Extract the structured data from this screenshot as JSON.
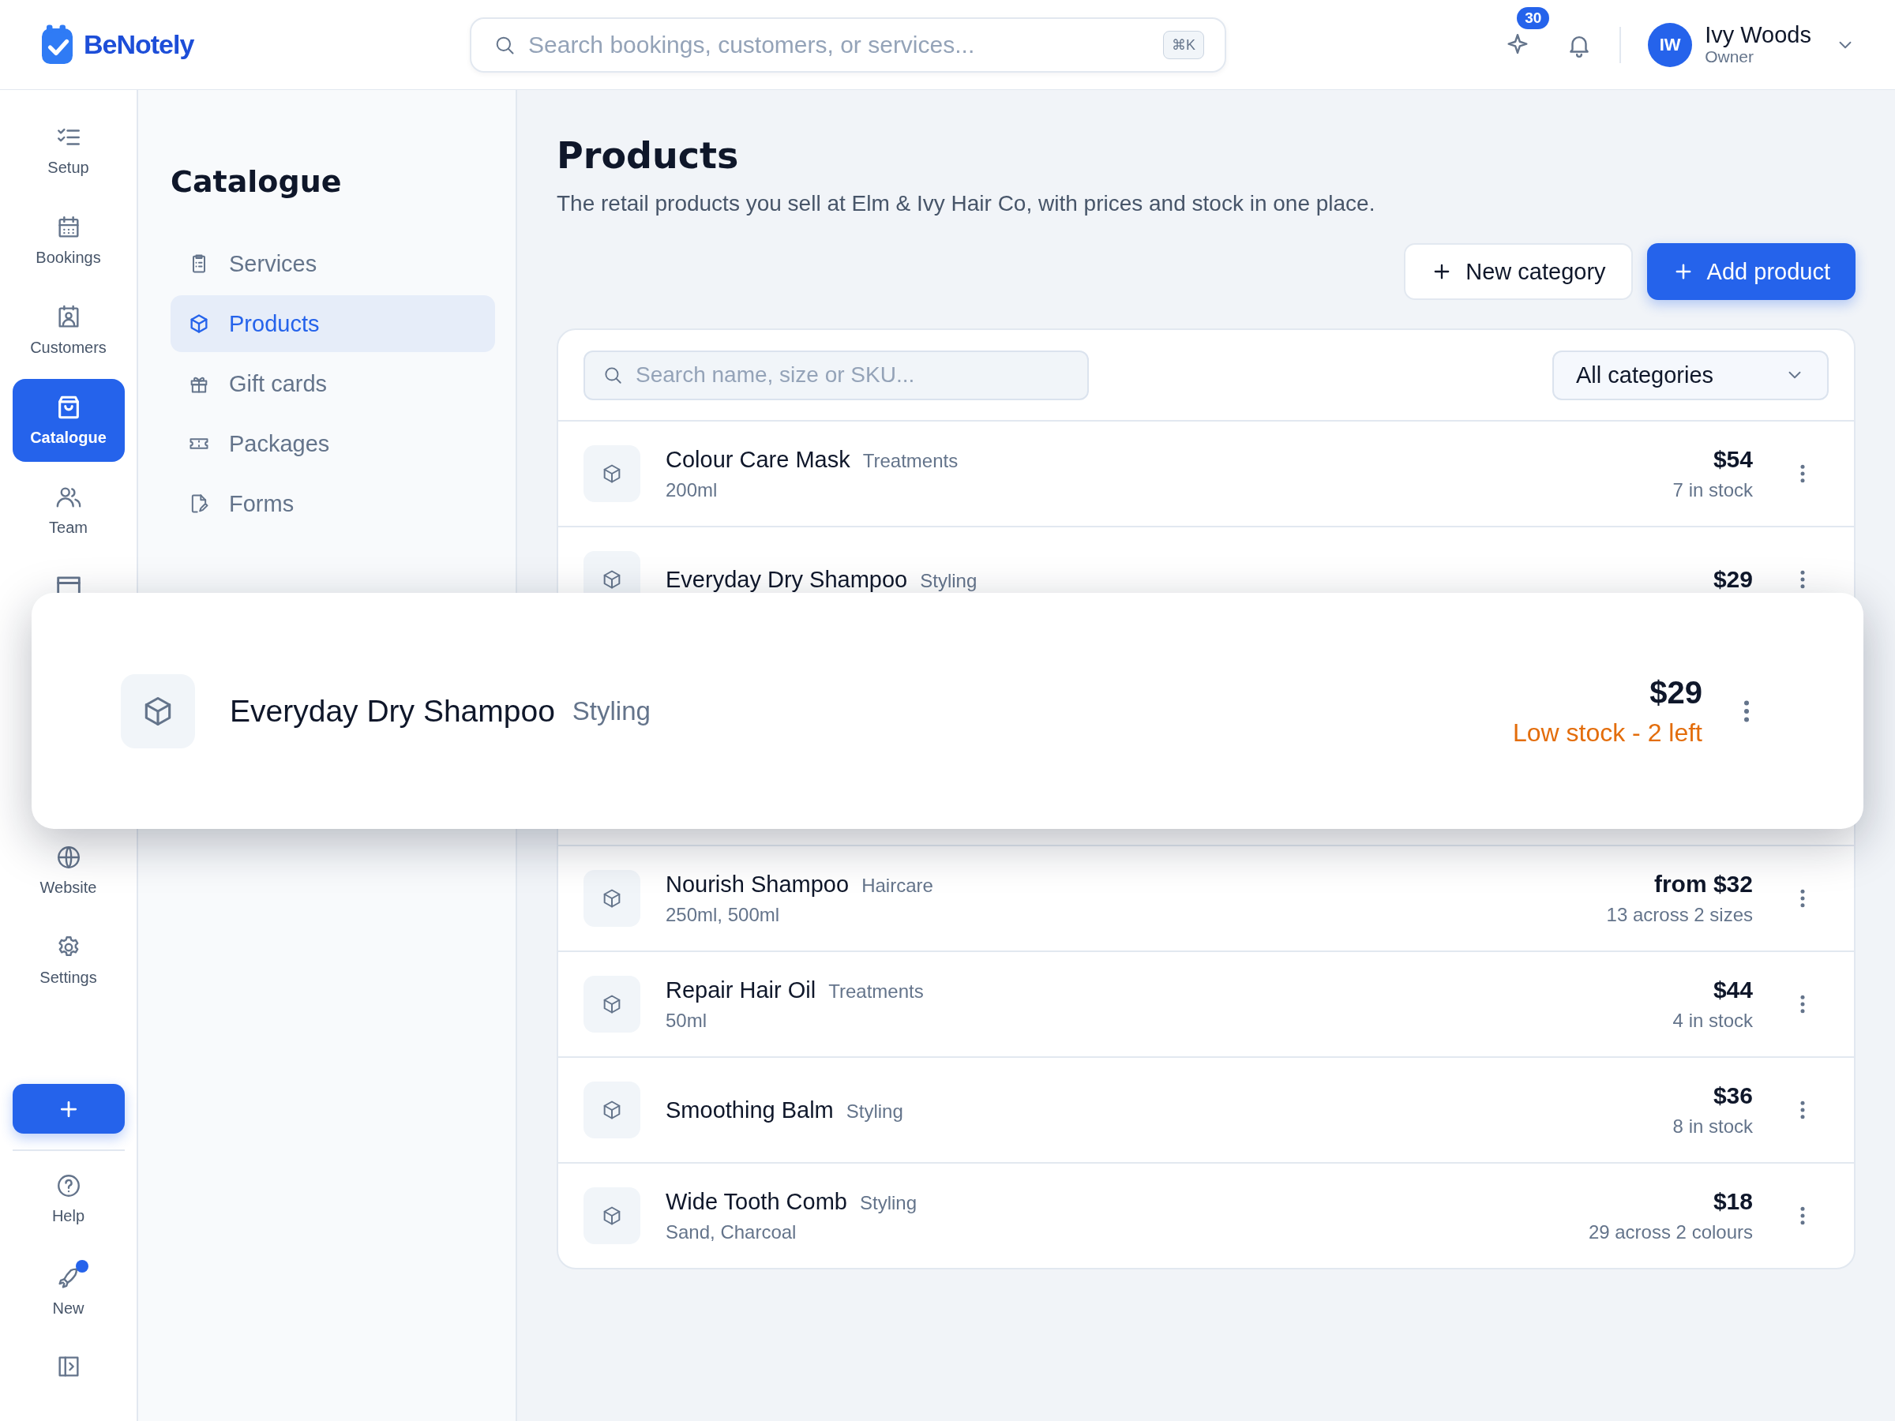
{
  "brand": {
    "name": "BeNotely"
  },
  "search": {
    "placeholder": "Search bookings, customers, or services...",
    "shortcut": "⌘K"
  },
  "header": {
    "whats_new_count": "30",
    "user": {
      "initials": "IW",
      "name": "Ivy Woods",
      "role": "Owner"
    }
  },
  "rail": {
    "items": [
      {
        "label": "Setup",
        "selected": false
      },
      {
        "label": "Bookings",
        "selected": false
      },
      {
        "label": "Customers",
        "selected": false
      },
      {
        "label": "Catalogue",
        "selected": true
      },
      {
        "label": "Team",
        "selected": false
      }
    ],
    "lower_items": [
      {
        "label": "Website",
        "selected": false
      },
      {
        "label": "Settings",
        "selected": false
      }
    ],
    "bottom": [
      {
        "label": "Help",
        "dot": false
      },
      {
        "label": "New",
        "dot": true
      }
    ]
  },
  "catalogue_menu": {
    "title": "Catalogue",
    "items": [
      {
        "label": "Services",
        "selected": false
      },
      {
        "label": "Products",
        "selected": true
      },
      {
        "label": "Gift cards",
        "selected": false
      },
      {
        "label": "Packages",
        "selected": false
      },
      {
        "label": "Forms",
        "selected": false
      }
    ]
  },
  "page": {
    "title": "Products",
    "subtitle": "The retail products you sell at Elm & Ivy Hair Co, with prices and stock in one place.",
    "buttons": [
      {
        "label": "New category",
        "kind": "secondary"
      },
      {
        "label": "Add product",
        "kind": "primary"
      }
    ]
  },
  "filters": {
    "search_placeholder": "Search name, size or SKU...",
    "category": "All categories"
  },
  "products_top": [
    {
      "name": "Colour Care Mask",
      "category": "Treatments",
      "variants": "200ml",
      "price": "$54",
      "stock": "7 in stock",
      "low_stock": false
    },
    {
      "name": "Everyday Dry Shampoo",
      "category": "Styling",
      "price": "$29"
    }
  ],
  "products_bottom": [
    {
      "name": "Nourish Shampoo",
      "category": "Haircare",
      "variants": "250ml, 500ml",
      "price": "from $32",
      "stock": "13 across 2 sizes",
      "low_stock": false
    },
    {
      "name": "Repair Hair Oil",
      "category": "Treatments",
      "variants": "50ml",
      "price": "$44",
      "stock": "4 in stock",
      "low_stock": false
    },
    {
      "name": "Smoothing Balm",
      "category": "Styling",
      "price": "$36",
      "stock": "8 in stock",
      "low_stock": false
    },
    {
      "name": "Wide Tooth Comb",
      "category": "Styling",
      "variants": "Sand, Charcoal",
      "price": "$18",
      "stock": "29 across 2 colours",
      "low_stock": false
    }
  ],
  "focus_card": {
    "name": "Everyday Dry Shampoo",
    "category": "Styling",
    "price": "$29",
    "stock": "Low stock - 2 left",
    "low_stock": true
  }
}
